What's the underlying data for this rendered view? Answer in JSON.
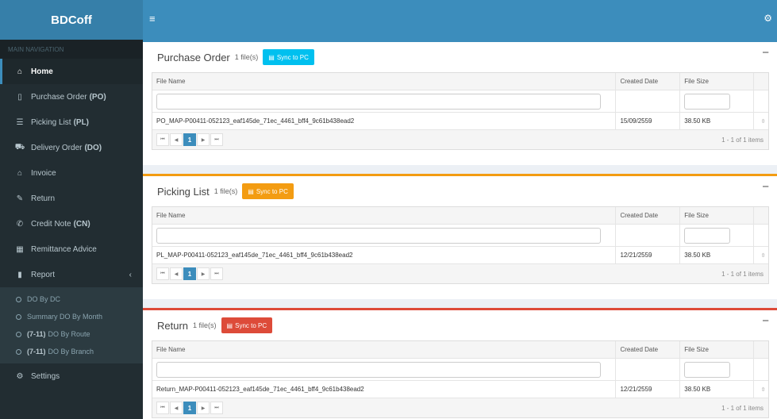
{
  "app": {
    "logo": "BDCoff"
  },
  "topbar": {
    "hamburger": "≡",
    "gear": "⚙"
  },
  "sidebar": {
    "header": "MAIN NAVIGATION",
    "items": [
      {
        "icon": "⌂",
        "label": "Home",
        "suffix": ""
      },
      {
        "icon": "▯",
        "label": "Purchase Order",
        "suffix": "(PO)"
      },
      {
        "icon": "☰",
        "label": "Picking List",
        "suffix": "(PL)"
      },
      {
        "icon": "⛟",
        "label": "Delivery Order",
        "suffix": "(DO)"
      },
      {
        "icon": "⌂",
        "label": "Invoice",
        "suffix": ""
      },
      {
        "icon": "✎",
        "label": "Return",
        "suffix": ""
      },
      {
        "icon": "✆",
        "label": "Credit Note",
        "suffix": "(CN)"
      },
      {
        "icon": "▦",
        "label": "Remittance Advice",
        "suffix": ""
      },
      {
        "icon": "▮",
        "label": "Report",
        "suffix": "",
        "chevron": "‹"
      }
    ],
    "report_sub": [
      {
        "prefix": "",
        "label": "DO By DC"
      },
      {
        "prefix": "",
        "label": "Summary DO By Month"
      },
      {
        "prefix": "(7-11)",
        "label": "DO By Route"
      },
      {
        "prefix": "(7-11)",
        "label": "DO By Branch"
      }
    ],
    "settings": {
      "icon": "⚙",
      "label": "Settings"
    }
  },
  "columns": {
    "file_name": "File Name",
    "created": "Created Date",
    "size": "File Size"
  },
  "pager": {
    "first": "⏮",
    "prev": "◀",
    "page": "1",
    "next": "▶",
    "last": "⏭",
    "info": "1 - 1 of 1 items"
  },
  "sections": [
    {
      "title": "Purchase Order",
      "count": "1 file(s)",
      "sync": "Sync to PC",
      "row": {
        "name": "PO_MAP-P00411-052123_eaf145de_71ec_4461_bff4_9c61b438ead2",
        "date": "15/09/2559",
        "size": "38.50 KB"
      }
    },
    {
      "title": "Picking List",
      "count": "1 file(s)",
      "sync": "Sync to PC",
      "row": {
        "name": "PL_MAP-P00411-052123_eaf145de_71ec_4461_bff4_9c61b438ead2",
        "date": "12/21/2559",
        "size": "38.50 KB"
      }
    },
    {
      "title": "Return",
      "count": "1 file(s)",
      "sync": "Sync to PC",
      "row": {
        "name": "Return_MAP-P00411-052123_eaf145de_71ec_4461_bff4_9c61b438ead2",
        "date": "12/21/2559",
        "size": "38.50 KB"
      }
    }
  ],
  "colors": {
    "sidebar": "#222d32",
    "topbar": "#3c8dbc",
    "info": "#00c0ef",
    "warning": "#f39c12",
    "danger": "#dd4b39"
  }
}
